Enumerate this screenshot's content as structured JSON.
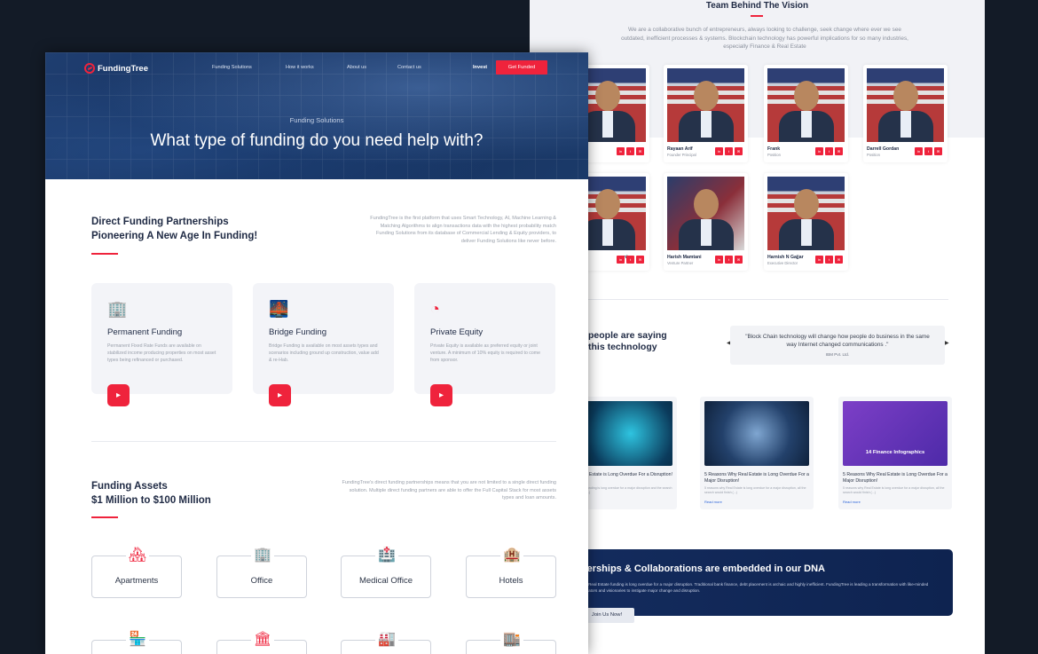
{
  "brand": {
    "name": "FundingTree",
    "accent": "#ef233c",
    "navy": "#1f2a44"
  },
  "nav": {
    "items": [
      "Funding Solutions",
      "How it works",
      "About us",
      "Contact us"
    ],
    "invest": "Invest",
    "cta": "Get Funded"
  },
  "hero": {
    "subtitle": "Funding Solutions",
    "title": "What type of funding do you need help with?"
  },
  "direct": {
    "title_line1": "Direct Funding Partnerships",
    "title_line2": "Pioneering A New Age In Funding!",
    "description": "FundingTree is the first platform that uses Smart Technology, AI, Machine Learning & Matching Algorithms to align transactions data with the highest probability match Funding Solutions from its database of Commercial Lending & Equity providers, to deliver Funding Solutions like never before."
  },
  "funding_cards": [
    {
      "icon": "building-icon",
      "glyph": "🏢",
      "title": "Permanent Funding",
      "desc": "Permanent Fixed Rate Funds are available on stabilized income producing properties on most asset types being refinanced or purchased."
    },
    {
      "icon": "bridge-icon",
      "glyph": "🌉",
      "title": "Bridge Funding",
      "desc": "Bridge Funding is available on most assets types and scenarios including ground up construction, value add & re-Hab."
    },
    {
      "icon": "pie-chart-icon",
      "glyph": "◔",
      "title": "Private Equity",
      "desc": "Private Equity is available as preferred equity or joint venture. A minimum of 10% equity is required to come from sponsor."
    }
  ],
  "assets": {
    "title_line1": "Funding Assets",
    "title_line2": "$1 Million to $100 Million",
    "description": "FundingTree's direct funding partnerships means that you are not limited to a single direct funding solution. Multiple direct funding partners are able to offer the Full Capital Stack for most assets types and loan amounts.",
    "items": [
      {
        "label": "Apartments",
        "icon": "apartments-icon",
        "glyph": "🏘"
      },
      {
        "label": "Office",
        "icon": "office-icon",
        "glyph": "🏢"
      },
      {
        "label": "Medical Office",
        "icon": "medical-office-icon",
        "glyph": "🏥"
      },
      {
        "label": "Hotels",
        "icon": "hotels-icon",
        "glyph": "🏨"
      }
    ],
    "row2_icons": [
      {
        "icon": "retail-icon",
        "glyph": "🏪"
      },
      {
        "icon": "bank-icon",
        "glyph": "🏛"
      },
      {
        "icon": "industrial-icon",
        "glyph": "🏭"
      },
      {
        "icon": "mixed-use-icon",
        "glyph": "🏬"
      }
    ]
  },
  "team": {
    "title": "Team Behind The Vision",
    "description": "We are a collaborative bunch of entrepreneurs, always looking to challenge, seek change where ever we see outdated, inefficient processes & systems. Blockchain technology has powerful implications for so many industries, especially Finance & Real Estate",
    "members": [
      {
        "name": "",
        "role": ""
      },
      {
        "name": "Rayaan Arif",
        "role": "Founder Principal"
      },
      {
        "name": "Frank",
        "role": "Position"
      },
      {
        "name": "Darrell Gordan",
        "role": "Position"
      },
      {
        "name": "ni",
        "role": ""
      },
      {
        "name": "Harish Mamtani",
        "role": "Venture Partner"
      },
      {
        "name": "Harnish N Gajjar",
        "role": "Executive Director"
      }
    ]
  },
  "testimonial": {
    "title_line1": "people are saying",
    "title_line2": "this technology",
    "quote": "\"Block Chain technology will change how people do business in the same way Internet changed communications .\"",
    "author": "IBM Pvt. Ltd."
  },
  "blogs": [
    {
      "title": "Why Real Estate is Long Overdue For a Disruption!",
      "desc": "Real Estate Funding is long overdue for a major disruption and the search would finish (...)",
      "more": ""
    },
    {
      "title": "5 Reasons Why Real Estate is Long Overdue For a Major Disruption!",
      "desc": "5 reasons why Real Estate is long overdue for a major disruption, all the search would finish (...)",
      "more": "Read more"
    },
    {
      "title": "5 Reasons Why Real Estate is Long Overdue For a Major Disruption!",
      "desc": "5 reasons why Real Estate is long overdue for a major disruption, all the search would finish (...)",
      "more": "Read more",
      "image_text": "14 Finance Infographics"
    }
  ],
  "cta": {
    "title": "rtnerships & Collaborations are embedded in our DNA",
    "desc": "mercial Real Estate funding is long overdue for a major disruption. Traditional bank finance, debt placement is archaic and highly inefficient. FundingTree is leading a transformation with like-minded collaborators and visionaries to instigate major change and disruption.",
    "button": "Join Us Now!"
  }
}
